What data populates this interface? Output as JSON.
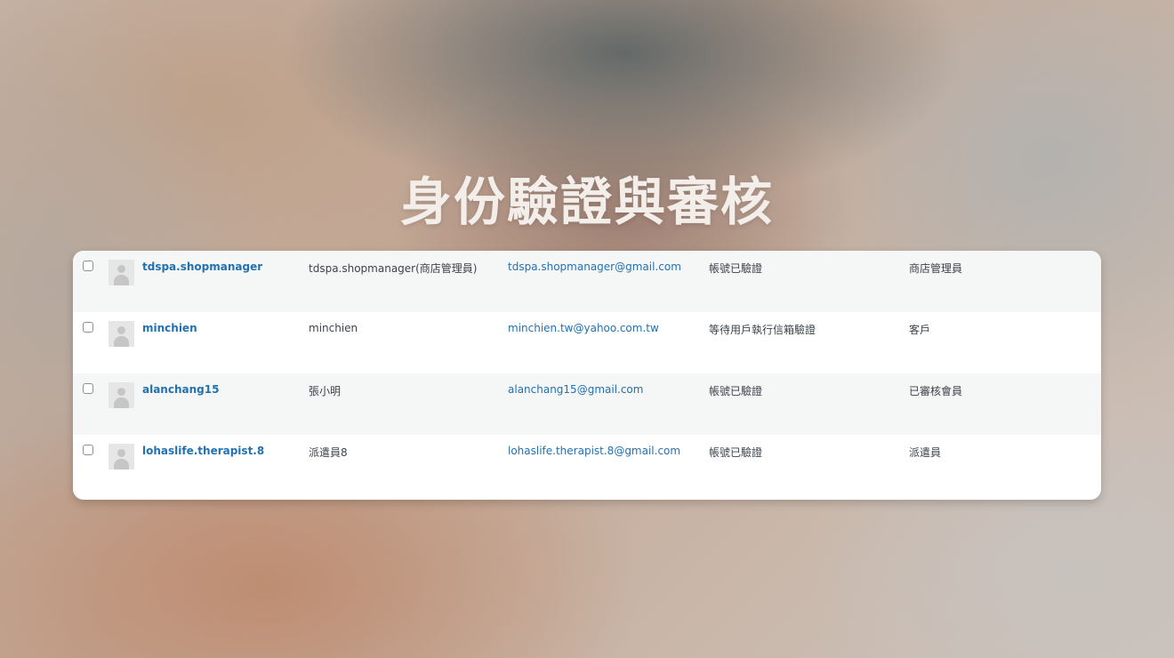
{
  "page": {
    "title": "身份驗證與審核"
  },
  "users": [
    {
      "username": "tdspa.shopmanager",
      "display_name": "tdspa.shopmanager(商店管理員)",
      "email": "tdspa.shopmanager@gmail.com",
      "status": "帳號已驗證",
      "role": "商店管理員"
    },
    {
      "username": "minchien",
      "display_name": "minchien",
      "email": "minchien.tw@yahoo.com.tw",
      "status": "等待用戶執行信箱驗證",
      "role": "客戶"
    },
    {
      "username": "alanchang15",
      "display_name": "張小明",
      "email": "alanchang15@gmail.com",
      "status": "帳號已驗證",
      "role": "已審核會員"
    },
    {
      "username": "lohaslife.therapist.8",
      "display_name": "派遣員8",
      "email": "lohaslife.therapist.8@gmail.com",
      "status": "帳號已驗證",
      "role": "派遣員"
    }
  ],
  "icons": {
    "avatar": "avatar-placeholder-icon",
    "checkbox": "checkbox"
  },
  "colors": {
    "link": "#2271b1",
    "text": "#3c434a",
    "row_alt": "#f5f6f6"
  }
}
